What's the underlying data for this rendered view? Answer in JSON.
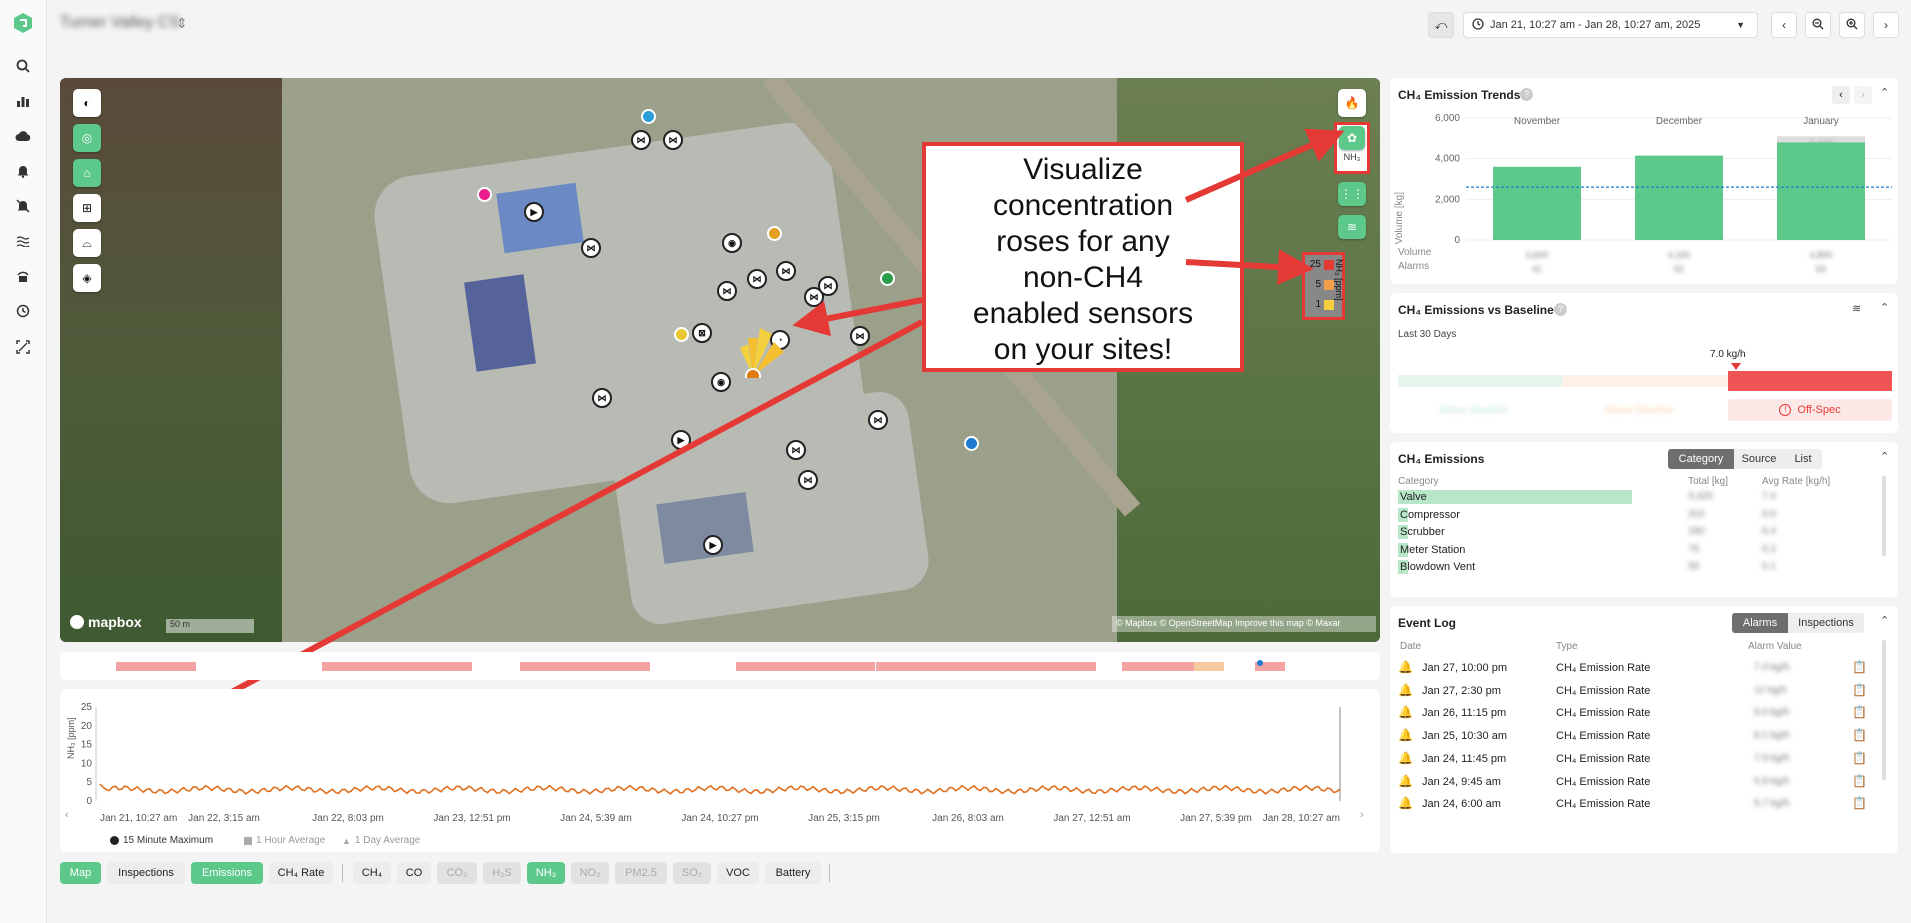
{
  "header": {
    "site_name": "Turner Valley CS",
    "date_range": "Jan 21, 10:27 am - Jan 28, 10:27 am, 2025"
  },
  "nav_icons": [
    "logo-icon",
    "search-icon",
    "chart-icon",
    "cloud-icon",
    "bell-icon",
    "alarm-off-icon",
    "waves-icon",
    "sensor-icon",
    "history-icon",
    "scan-icon"
  ],
  "map": {
    "callout": [
      "Visualize",
      "concentration",
      "roses for any",
      "non-CH4",
      "enabled sensors",
      "on your sites!"
    ],
    "brand": "mapbox",
    "scale": "50 m",
    "attribution": "© Mapbox © OpenStreetMap Improve this map © Maxar",
    "nh3_toggle_label": "NH₃",
    "legend": {
      "title": "NH₃ [ppm]",
      "levels": [
        {
          "value": "25",
          "color": "#e53935"
        },
        {
          "value": "5",
          "color": "#f4a04a"
        },
        {
          "value": "1",
          "color": "#f4d03f"
        }
      ]
    }
  },
  "chart_data": {
    "type": "line",
    "title": "",
    "xlabel": "",
    "ylabel": "NH₃ [ppm]",
    "yticks": [
      "25",
      "20",
      "15",
      "10",
      "5",
      "0"
    ],
    "ylim": [
      0,
      25
    ],
    "xticks": [
      "Jan 21, 10:27 am",
      "Jan 22, 3:15 am",
      "Jan 22, 8:03 pm",
      "Jan 23, 12:51 pm",
      "Jan 24, 5:39 am",
      "Jan 24, 10:27 pm",
      "Jan 25, 3:15 pm",
      "Jan 26, 8:03 am",
      "Jan 27, 12:51 am",
      "Jan 27, 5:39 pm",
      "Jan 28, 10:27 am"
    ],
    "series": [
      {
        "name": "15 Minute Maximum",
        "color": "#e07020",
        "approx_level_ppm": 3
      }
    ],
    "legend": [
      "15 Minute Maximum",
      "1 Hour Average",
      "1 Day Average"
    ]
  },
  "bottom_toolbar": {
    "view": [
      {
        "label": "Map",
        "state": "on"
      },
      {
        "label": "Inspections",
        "state": "off"
      },
      {
        "label": "Emissions",
        "state": "on"
      },
      {
        "label": "CH₄ Rate",
        "state": "off"
      }
    ],
    "gases": [
      {
        "label": "CH₄",
        "state": "off"
      },
      {
        "label": "CO",
        "state": "off"
      },
      {
        "label": "CO₂",
        "state": "dis"
      },
      {
        "label": "H₂S",
        "state": "dis"
      },
      {
        "label": "NH₃",
        "state": "on"
      },
      {
        "label": "NO₂",
        "state": "dis"
      },
      {
        "label": "PM2.5",
        "state": "dis"
      },
      {
        "label": "SO₂",
        "state": "dis"
      },
      {
        "label": "VOC",
        "state": "off"
      },
      {
        "label": "Battery",
        "state": "off"
      }
    ]
  },
  "trends": {
    "title": "CH₄ Emission Trends",
    "ylabel": "Volume [kg]",
    "yticks": [
      "6,000",
      "4,000",
      "2,000",
      "0"
    ],
    "months": [
      "November",
      "December",
      "January"
    ],
    "values_kg": [
      3600,
      4150,
      4800
    ],
    "row_labels": [
      "Volume",
      "Alarms"
    ],
    "volumes": [
      "3,600",
      "4,150",
      "4,800"
    ],
    "alarms": [
      "41",
      "52",
      "63"
    ],
    "top_label": "5,100"
  },
  "baseline": {
    "title": "CH₄ Emissions vs Baseline",
    "subtitle": "Last 30 Days",
    "value": "7.0 kg/h",
    "labels": [
      "Below Baseline",
      "Above Baseline",
      "Off-Spec"
    ]
  },
  "emissions": {
    "title": "CH₄ Emissions",
    "tabs": [
      "Category",
      "Source",
      "List"
    ],
    "columns": [
      "Category",
      "Total [kg]",
      "Avg Rate [kg/h]"
    ],
    "rows": [
      {
        "name": "Valve",
        "total": "3,420",
        "rate": "7.4"
      },
      {
        "name": "Compressor",
        "total": "310",
        "rate": "0.6"
      },
      {
        "name": "Scrubber",
        "total": "180",
        "rate": "0.4"
      },
      {
        "name": "Meter Station",
        "total": "75",
        "rate": "0.2"
      },
      {
        "name": "Blowdown Vent",
        "total": "50",
        "rate": "0.1"
      }
    ]
  },
  "event_log": {
    "title": "Event Log",
    "tabs": [
      "Alarms",
      "Inspections"
    ],
    "columns": [
      "Date",
      "Type",
      "Alarm Value"
    ],
    "rows": [
      {
        "date": "Jan 27, 10:00 pm",
        "type": "CH₄ Emission Rate",
        "value": "7.4 kg/h"
      },
      {
        "date": "Jan 27, 2:30 pm",
        "type": "CH₄ Emission Rate",
        "value": "12 kg/h"
      },
      {
        "date": "Jan 26, 11:15 pm",
        "type": "CH₄ Emission Rate",
        "value": "9.6 kg/h"
      },
      {
        "date": "Jan 25, 10:30 am",
        "type": "CH₄ Emission Rate",
        "value": "8.1 kg/h"
      },
      {
        "date": "Jan 24, 11:45 pm",
        "type": "CH₄ Emission Rate",
        "value": "7.9 kg/h"
      },
      {
        "date": "Jan 24, 9:45 am",
        "type": "CH₄ Emission Rate",
        "value": "6.8 kg/h"
      },
      {
        "date": "Jan 24, 6:00 am",
        "type": "CH₄ Emission Rate",
        "value": "5.7 kg/h"
      }
    ]
  }
}
